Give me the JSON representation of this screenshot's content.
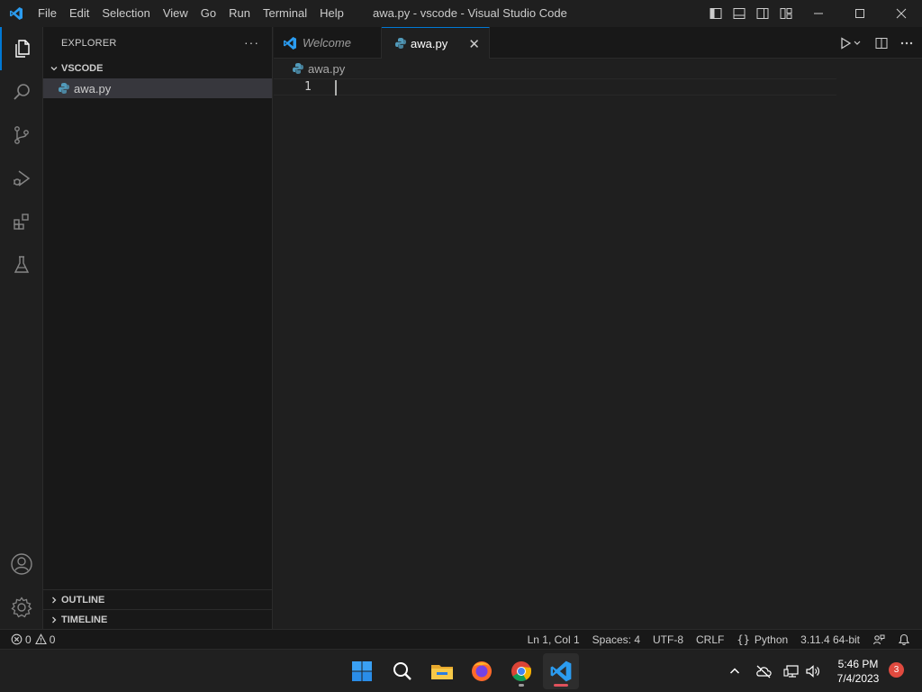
{
  "titlebar": {
    "menu": [
      "File",
      "Edit",
      "Selection",
      "View",
      "Go",
      "Run",
      "Terminal",
      "Help"
    ],
    "window_title": "awa.py - vscode - Visual Studio Code"
  },
  "activitybar": {
    "items": [
      "explorer-icon",
      "search-icon",
      "source-control-icon",
      "run-debug-icon",
      "extensions-icon",
      "testing-icon"
    ],
    "bottom": [
      "accounts-icon",
      "manage-gear-icon"
    ]
  },
  "sidebar": {
    "title": "EXPLORER",
    "more": "···",
    "folder": "VSCODE",
    "files": [
      {
        "name": "awa.py"
      }
    ],
    "outline": "OUTLINE",
    "timeline": "TIMELINE"
  },
  "editor": {
    "tabs": [
      {
        "label": "Welcome"
      },
      {
        "label": "awa.py",
        "close": "✕"
      }
    ],
    "breadcrumb": "awa.py",
    "line_number": "1"
  },
  "statusbar": {
    "errors": "0",
    "warnings": "0",
    "position": "Ln 1, Col 1",
    "spaces": "Spaces: 4",
    "encoding": "UTF-8",
    "eol": "CRLF",
    "language": "Python",
    "interpreter": "3.11.4 64-bit"
  },
  "taskbar": {
    "time": "5:46 PM",
    "date": "7/4/2023",
    "notification_count": "3"
  },
  "colors": {
    "accent": "#0078d4",
    "python_blue": "#519aba",
    "badge": "#e04a3f"
  }
}
